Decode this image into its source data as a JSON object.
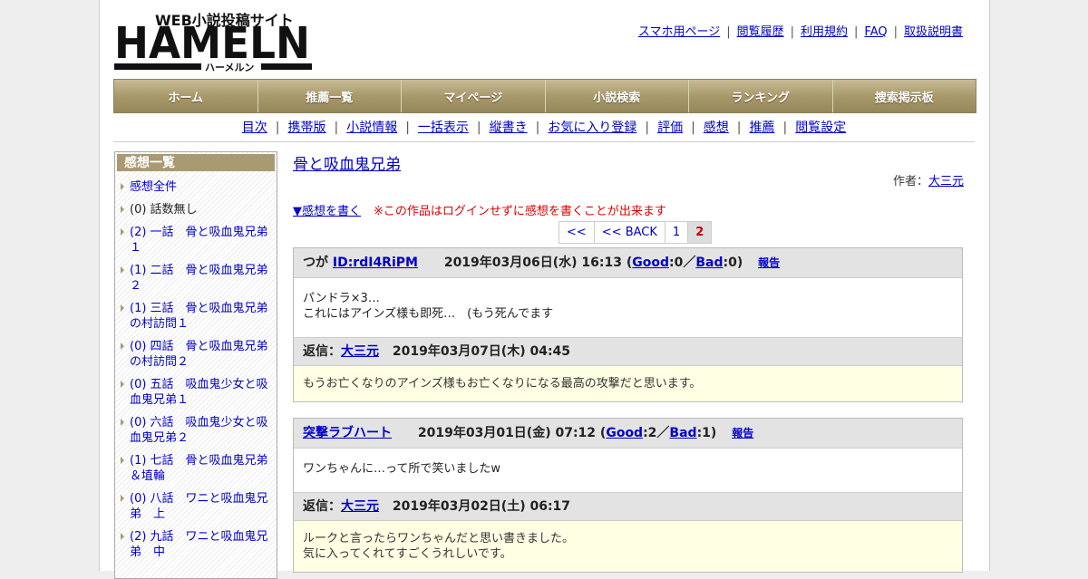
{
  "site": {
    "logo_text": "HAMELN",
    "logo_subtitle": "WEB小説投稿サイト",
    "logo_kana": "ハーメルン"
  },
  "top_links": [
    "スマホ用ページ",
    "閲覧履歴",
    "利用規約",
    "FAQ",
    "取扱説明書"
  ],
  "main_nav": [
    "ホーム",
    "推薦一覧",
    "マイページ",
    "小説検索",
    "ランキング",
    "捜索掲示板"
  ],
  "sub_nav": [
    "目次",
    "携帯版",
    "小説情報",
    "一括表示",
    "縦書き",
    "お気に入り登録",
    "評価",
    "感想",
    "推薦",
    "閲覧設定"
  ],
  "sidebar": {
    "title": "感想一覧",
    "items": [
      {
        "text": "感想全件",
        "link": true
      },
      {
        "text": "(0) 話数無し",
        "link": false
      },
      {
        "text": "(2) 一話　骨と吸血鬼兄弟１",
        "link": true
      },
      {
        "text": "(1) 二話　骨と吸血鬼兄弟２",
        "link": true
      },
      {
        "text": "(1) 三話　骨と吸血鬼兄弟の村訪問１",
        "link": true
      },
      {
        "text": "(0) 四話　骨と吸血鬼兄弟の村訪問２",
        "link": true
      },
      {
        "text": "(0) 五話　吸血鬼少女と吸血鬼兄弟１",
        "link": true
      },
      {
        "text": "(0) 六話　吸血鬼少女と吸血鬼兄弟２",
        "link": true
      },
      {
        "text": "(1) 七話　骨と吸血鬼兄弟＆埴輪",
        "link": true
      },
      {
        "text": "(0) 八話　ワニと吸血鬼兄弟　上",
        "link": true
      },
      {
        "text": "(2) 九話　ワニと吸血鬼兄弟　中",
        "link": true
      }
    ]
  },
  "novel": {
    "title": "骨と吸血鬼兄弟",
    "author_label": "作者：",
    "author": "大三元"
  },
  "write_link": "▼感想を書く",
  "login_notice": "※この作品はログインせずに感想を書くことが出来ます",
  "pager": [
    "<<",
    "<< BACK",
    "1",
    "2"
  ],
  "pager_current": "2",
  "reviews": [
    {
      "name": "つが",
      "user_id": "ID:rdI4RiPM",
      "date": "2019年03月06日(水) 16:13",
      "good_label": "Good",
      "good": ":0",
      "bad_label": "Bad",
      "bad": ":0",
      "report": "報告",
      "body": [
        "パンドラ×3…",
        "これにはアインズ様も即死…　(もう死んでます"
      ],
      "reply_label": "返信：",
      "reply_author": "大三元",
      "reply_date": "2019年03月07日(木) 04:45",
      "reply_body": [
        "もうお亡くなりのアインズ様もお亡くなりになる最高の攻撃だと思います。"
      ]
    },
    {
      "name": "突撃ラブハート",
      "user_id": "",
      "date": "2019年03月01日(金) 07:12",
      "good_label": "Good",
      "good": ":2",
      "bad_label": "Bad",
      "bad": ":1",
      "report": "報告",
      "body": [
        "ワンちゃんに…って所で笑いましたw"
      ],
      "reply_label": "返信：",
      "reply_author": "大三元",
      "reply_date": "2019年03月02日(土) 06:17",
      "reply_body": [
        "ルークと言ったらワンちゃんだと思い書きました。",
        "気に入ってくれてすごくうれしいです。"
      ]
    }
  ],
  "colors": {
    "nav_gold": "#a99a6c",
    "link": "#0000cc",
    "warn": "#e00000",
    "reply_bg": "#ffffe4"
  }
}
